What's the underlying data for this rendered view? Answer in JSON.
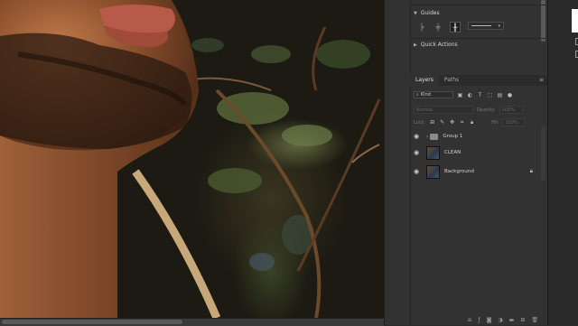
{
  "properties": {
    "guides_label": "Guides",
    "quick_actions_label": "Quick Actions"
  },
  "layers_panel": {
    "tabs": [
      {
        "label": "Layers"
      },
      {
        "label": "Paths"
      }
    ],
    "filter_kind": "Kind",
    "blend_mode": "Normal",
    "opacity_label": "Opacity:",
    "opacity_value": "100%",
    "lock_label": "Lock:",
    "fill_label": "Fill:",
    "fill_value": "100%",
    "layers": [
      {
        "name": "Group 1",
        "type": "group"
      },
      {
        "name": "CLEAN",
        "type": "pixel"
      },
      {
        "name": "Background",
        "type": "pixel",
        "locked": true
      }
    ]
  },
  "colors": {
    "panel_bg": "#323232",
    "panel_tab_bar": "#2b2b2b",
    "text": "#d0d0d0"
  },
  "icons": {
    "eye": "eye-icon",
    "lock": "lock-icon",
    "folder": "folder-icon"
  }
}
